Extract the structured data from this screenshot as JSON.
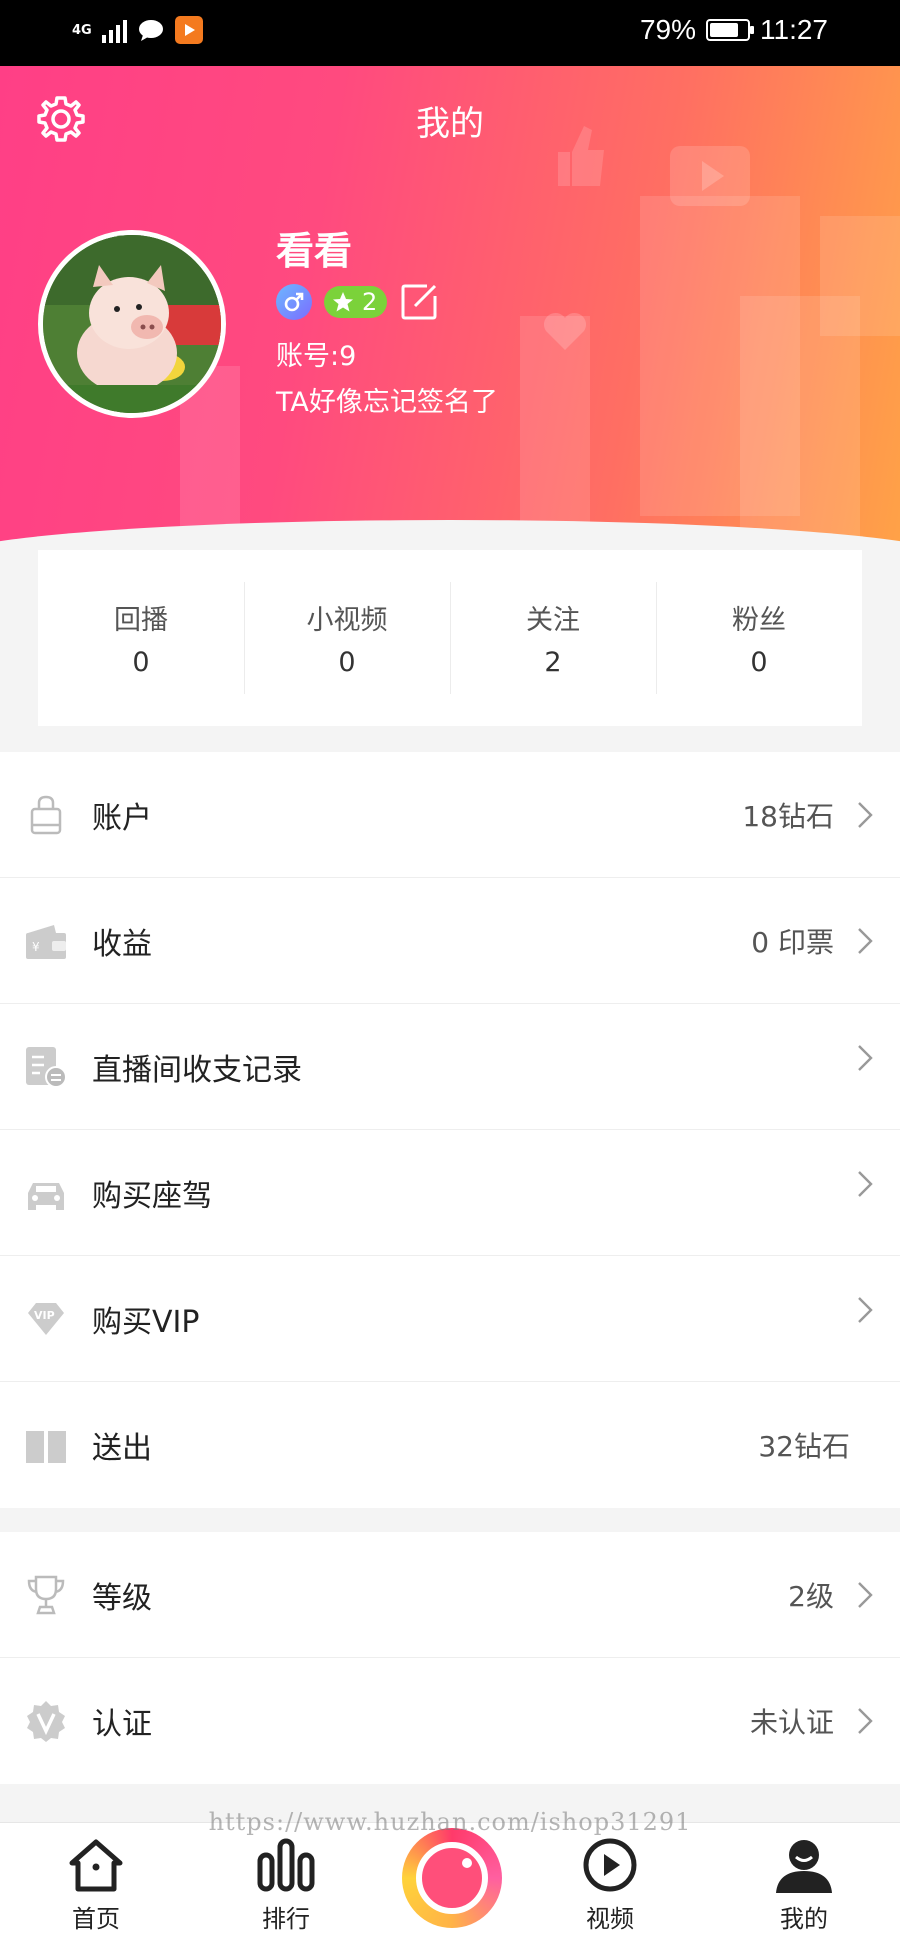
{
  "status_bar": {
    "network": "4G",
    "battery": "79%",
    "battery_level": 0.79,
    "time": "11:27"
  },
  "header": {
    "title": "我的",
    "settings_icon": "gear-icon"
  },
  "profile": {
    "name": "看看",
    "gender_icon": "male-icon",
    "level": "2",
    "account": "账号:9",
    "signature": "TA好像忘记签名了"
  },
  "stats": [
    {
      "label": "回播",
      "value": "0"
    },
    {
      "label": "小视频",
      "value": "0"
    },
    {
      "label": "关注",
      "value": "2"
    },
    {
      "label": "粉丝",
      "value": "0"
    }
  ],
  "menu_group_1": [
    {
      "icon": "bag-icon",
      "label": "账户",
      "value": "18钻石",
      "arrow": true
    },
    {
      "icon": "wallet-icon",
      "label": "收益",
      "value": "0 印票",
      "arrow": true
    },
    {
      "icon": "receipt-icon",
      "label": "直播间收支记录",
      "value": "",
      "arrow": true
    },
    {
      "icon": "car-icon",
      "label": "购买座驾",
      "value": "",
      "arrow": true
    },
    {
      "icon": "vip-icon",
      "label": "购买VIP",
      "value": "",
      "arrow": true
    },
    {
      "icon": "gift-icon",
      "label": "送出",
      "value": "32钻石",
      "arrow": false
    }
  ],
  "menu_group_2": [
    {
      "icon": "trophy-icon",
      "label": "等级",
      "value": "2级",
      "arrow": true
    },
    {
      "icon": "verified-icon",
      "label": "认证",
      "value": "未认证",
      "arrow": true
    }
  ],
  "watermark": "https://www.huzhan.com/ishop31291",
  "tabbar": [
    {
      "icon": "home-icon",
      "label": "首页"
    },
    {
      "icon": "ranking-icon",
      "label": "排行"
    },
    {
      "icon": "live-camera-icon",
      "label": ""
    },
    {
      "icon": "video-play-icon",
      "label": "视频"
    },
    {
      "icon": "profile-icon",
      "label": "我的"
    }
  ],
  "colors": {
    "gradient_start": "#ff3f86",
    "gradient_end": "#ffa247",
    "level_badge": "#7bd23a"
  }
}
